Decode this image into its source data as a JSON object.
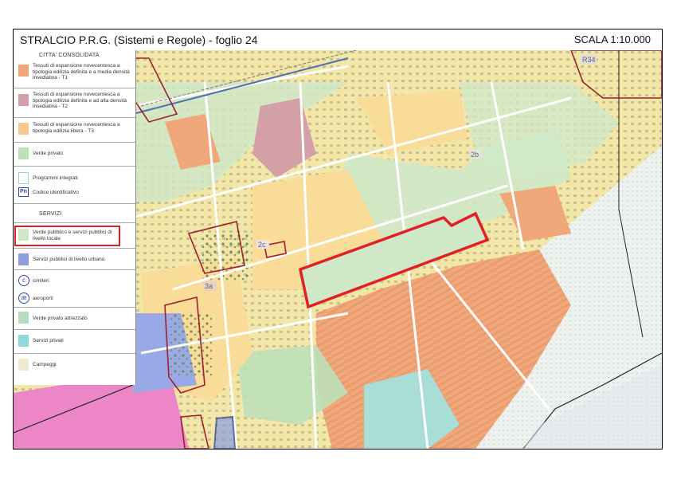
{
  "header": {
    "title": "STRALCIO P.R.G. (Sistemi e Regole) - foglio 24",
    "scale": "SCALA 1:10.000"
  },
  "legend": {
    "section_city": "CITTA' CONSOLIDATA",
    "items_city": [
      {
        "label": "Tessuti di espansione novecentesca a tipologia edilizia definita e a media densità insediativa - T1",
        "color": "#f0a87a"
      },
      {
        "label": "Tessuti di espansione novecentesca a tipologia edilizia definita e ad alta densità insediativa - T2",
        "color": "#d4a0a8"
      },
      {
        "label": "Tessuti di espansione novecentesca a tipologia edilizia libera - T3",
        "color": "#f8c98a"
      },
      {
        "label": "Verde privato",
        "color": "#bde0b8"
      },
      {
        "label": "Programmi integrati",
        "color": "#ffffff"
      },
      {
        "label": "Codice identificativo",
        "code": "Pn"
      }
    ],
    "section_services": "SERVIZI",
    "items_services": [
      {
        "label": "Verde pubblico e servizi pubblici di livello locale",
        "color": "#cfe8c8"
      },
      {
        "label": "Servizi pubblici di livello urbano",
        "color": "#8c9ee0"
      },
      {
        "label": "cimiteri",
        "symbol": "c"
      },
      {
        "label": "aeroporti",
        "symbol": "æ"
      },
      {
        "label": "Verde privato attrezzato",
        "color": "#b8dcc0"
      },
      {
        "label": "Servizi privati",
        "color": "#8fd8dc"
      },
      {
        "label": "Campeggi",
        "color": "#f0ead0"
      }
    ]
  },
  "map": {
    "zone_labels": [
      "R34",
      "2b",
      "2c",
      "3a"
    ],
    "colors": {
      "verde_pubblico": "#cfe8c8",
      "verde_privato": "#bde0b8",
      "t1_media": "#f0a87a",
      "t2_alta": "#d4a0a8",
      "t3_libera": "#f8dc98",
      "urbano": "#8c9ee0",
      "privati": "#9fdad8",
      "pink": "#ec86c6",
      "highlight": "#e31e24",
      "programmi": "#c22c3c"
    }
  }
}
